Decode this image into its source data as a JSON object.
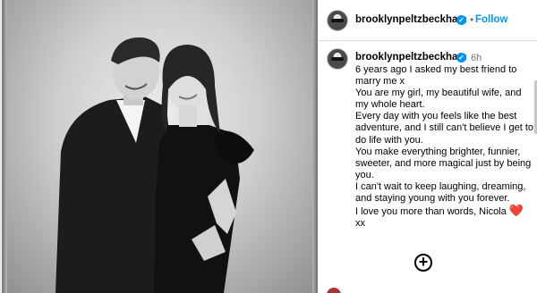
{
  "post": {
    "image_alt": "Black and white photo of a couple",
    "username": "brooklynpeltzbeckham",
    "follow_label": "Follow",
    "separator": "•",
    "verified_glyph": "✓",
    "time": "6h",
    "caption_lines": [
      "6 years ago I asked my best friend to marry me x",
      "You are my girl, my beautiful wife, and my whole heart.",
      "Every day with you feels like the best adventure, and I still can't believe I get to do life with you.",
      "You make everything brighter, funnier, sweeter, and more magical just by being you.",
      "I can't wait to keep laughing, dreaming, and staying young with you forever.",
      "I love you more than words, Nicola",
      "xx"
    ],
    "heart_emoji": "❤️",
    "add_comment_icon": "plus-circle-icon"
  }
}
